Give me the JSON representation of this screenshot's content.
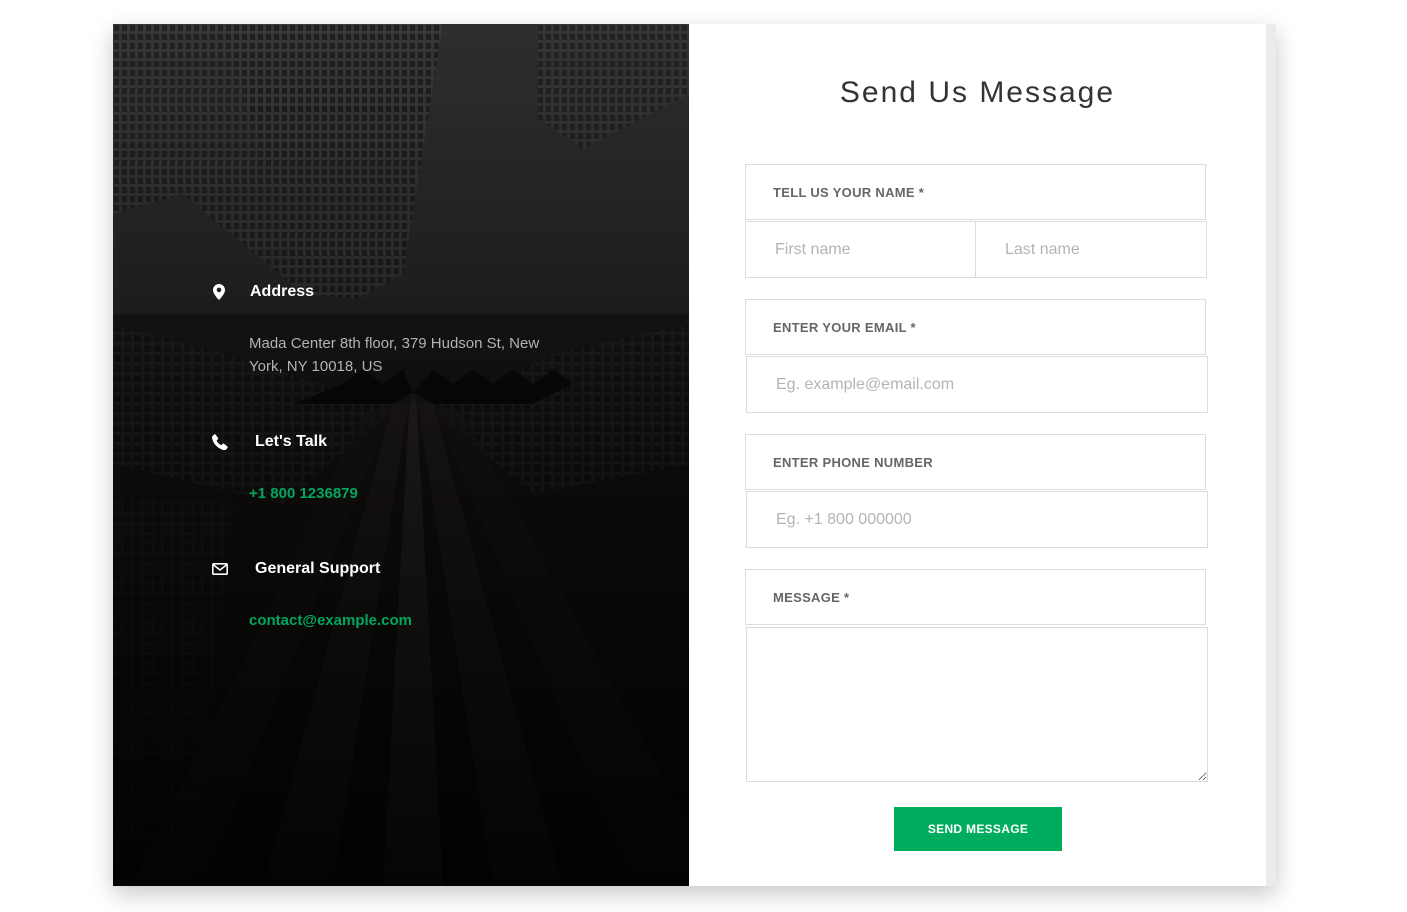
{
  "contact_info": {
    "address": {
      "title": "Address",
      "icon": "map-marker-icon",
      "text": "Mada Center 8th floor, 379 Hudson St, New York, NY 10018, US"
    },
    "talk": {
      "title": "Let's Talk",
      "icon": "phone-icon",
      "phone": "+1 800 1236879"
    },
    "support": {
      "title": "General Support",
      "icon": "envelope-icon",
      "email": "contact@example.com"
    }
  },
  "form": {
    "title": "Send Us Message",
    "name_label": "TELL US YOUR NAME *",
    "first_name_placeholder": "First name",
    "last_name_placeholder": "Last name",
    "email_label": "ENTER YOUR EMAIL *",
    "email_placeholder": "Eg. example@email.com",
    "phone_label": "ENTER PHONE NUMBER",
    "phone_placeholder": "Eg. +1 800 000000",
    "message_label": "MESSAGE *",
    "message_value": "",
    "submit_label": "SEND MESSAGE"
  },
  "colors": {
    "accent": "#00ad5f",
    "link_green": "#00a75e",
    "panel_dark": "#0d0c0b"
  }
}
